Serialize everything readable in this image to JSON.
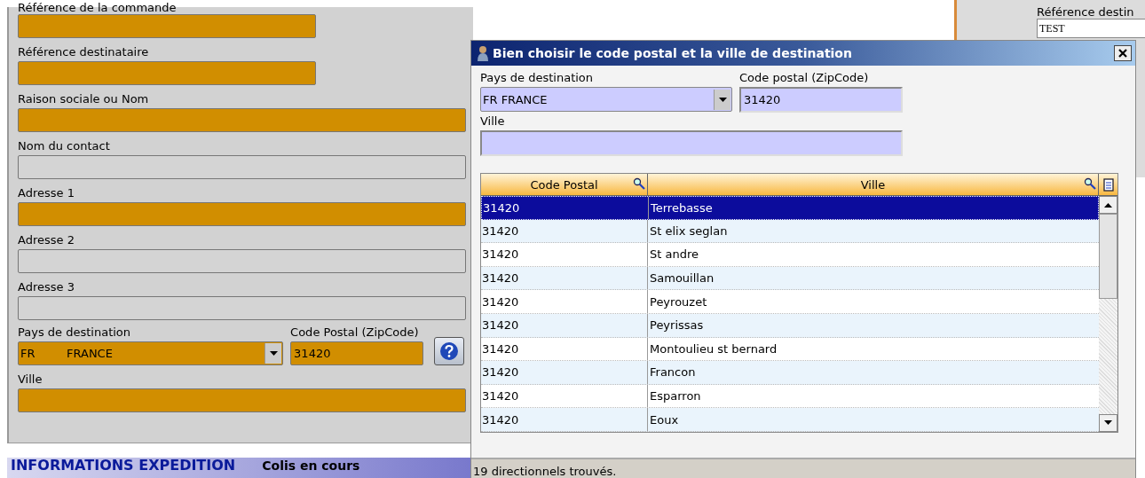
{
  "form": {
    "fields": [
      {
        "label": "Référence de la commande",
        "required": true,
        "wide": false
      },
      {
        "label": "Référence destinataire",
        "required": true,
        "wide": false
      },
      {
        "label": "Raison sociale ou Nom",
        "required": true,
        "wide": true
      },
      {
        "label": "Nom du contact",
        "required": false,
        "wide": true
      },
      {
        "label": "Adresse 1",
        "required": true,
        "wide": true
      },
      {
        "label": "Adresse 2",
        "required": false,
        "wide": true
      },
      {
        "label": "Adresse 3",
        "required": false,
        "wide": true
      }
    ],
    "country": {
      "label": "Pays de destination",
      "code": "FR",
      "name": "FRANCE"
    },
    "zip": {
      "label": "Code Postal (ZipCode)",
      "value": "31420"
    },
    "city": {
      "label": "Ville"
    }
  },
  "section": {
    "title": "INFORMATIONS EXPEDITION",
    "subtitle": "Colis en cours"
  },
  "side": {
    "label": "Référence destin",
    "value": "TEST"
  },
  "dialog": {
    "title": "Bien choisir le code postal et la ville de destination",
    "country": {
      "label": "Pays de destination",
      "value": "FR  FRANCE"
    },
    "zip": {
      "label": "Code postal (ZipCode)",
      "value": "31420"
    },
    "city": {
      "label": "Ville"
    },
    "table": {
      "columns": [
        "Code Postal",
        "Ville"
      ],
      "rows": [
        {
          "cells": [
            "31420",
            "Terrebasse"
          ],
          "selected": true
        },
        {
          "cells": [
            "31420",
            "St elix seglan"
          ],
          "selected": false
        },
        {
          "cells": [
            "31420",
            "St andre"
          ],
          "selected": false
        },
        {
          "cells": [
            "31420",
            "Samouillan"
          ],
          "selected": false
        },
        {
          "cells": [
            "31420",
            "Peyrouzet"
          ],
          "selected": false
        },
        {
          "cells": [
            "31420",
            "Peyrissas"
          ],
          "selected": false
        },
        {
          "cells": [
            "31420",
            "Montoulieu st bernard"
          ],
          "selected": false
        },
        {
          "cells": [
            "31420",
            "Francon"
          ],
          "selected": false
        },
        {
          "cells": [
            "31420",
            "Esparron"
          ],
          "selected": false
        },
        {
          "cells": [
            "31420",
            "Eoux"
          ],
          "selected": false
        }
      ]
    },
    "status": "19 directionnels trouvés."
  }
}
